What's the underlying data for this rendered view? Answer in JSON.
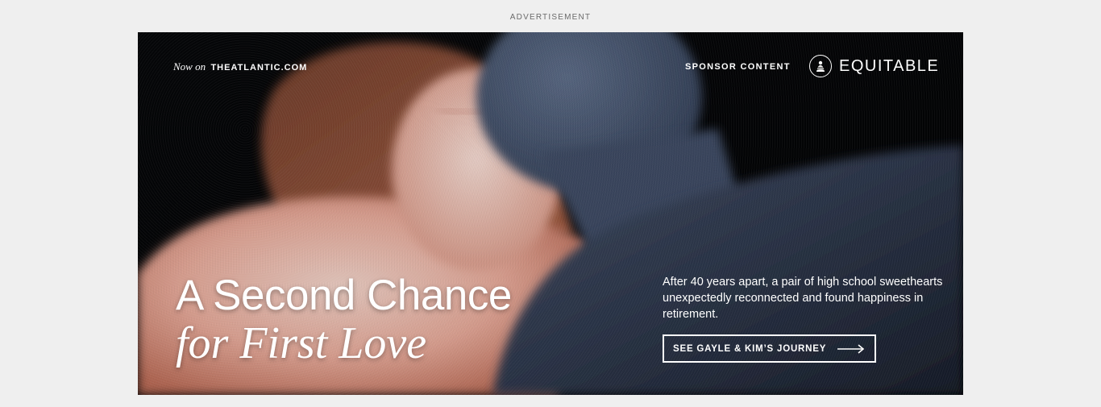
{
  "advertisement_label": "ADVERTISEMENT",
  "ad": {
    "now_on": "Now on",
    "site": "THEATLANTIC.COM",
    "sponsor_label": "SPONSOR CONTENT",
    "brand_name": "EQUITABLE",
    "headline_line1": "A Second Chance",
    "headline_line2": "for First Love",
    "blurb": "After 40 years apart, a pair of high school sweethearts unexpectedly reconnected and found happiness in retirement.",
    "cta_label": "SEE GAYLE & KIM’S JOURNEY",
    "icons": {
      "brand": "equitable-logo-icon",
      "cta": "arrow-right-icon"
    },
    "colors": {
      "background": "#000000",
      "text": "#ffffff",
      "page": "#efefef"
    }
  }
}
